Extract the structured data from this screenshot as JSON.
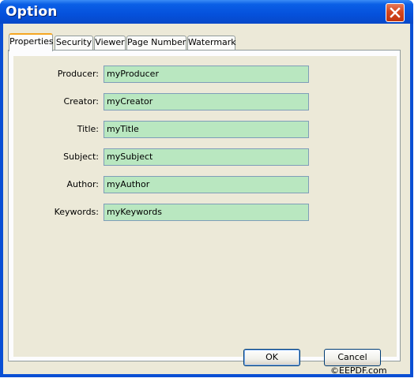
{
  "window": {
    "title": "Option"
  },
  "tabs": [
    {
      "label": "Properties",
      "active": true
    },
    {
      "label": "Security",
      "active": false
    },
    {
      "label": "Viewer",
      "active": false
    },
    {
      "label": "Page Number",
      "active": false
    },
    {
      "label": "Watermark",
      "active": false
    }
  ],
  "fields": {
    "producer": {
      "label": "Producer:",
      "value": "myProducer"
    },
    "creator": {
      "label": "Creator:",
      "value": "myCreator"
    },
    "title": {
      "label": "Title:",
      "value": "myTitle"
    },
    "subject": {
      "label": "Subject:",
      "value": "mySubject"
    },
    "author": {
      "label": "Author:",
      "value": "myAuthor"
    },
    "keywords": {
      "label": "Keywords:",
      "value": "myKeywords"
    }
  },
  "buttons": {
    "ok": "OK",
    "cancel": "Cancel"
  },
  "watermark": "©EEPDF.com",
  "icons": {
    "close": "close-icon"
  },
  "colors": {
    "titlebar": "#0551dc",
    "field_bg": "#b9e7c0",
    "active_tab_accent": "#f5a623",
    "dialog_bg": "#ece9d8"
  }
}
